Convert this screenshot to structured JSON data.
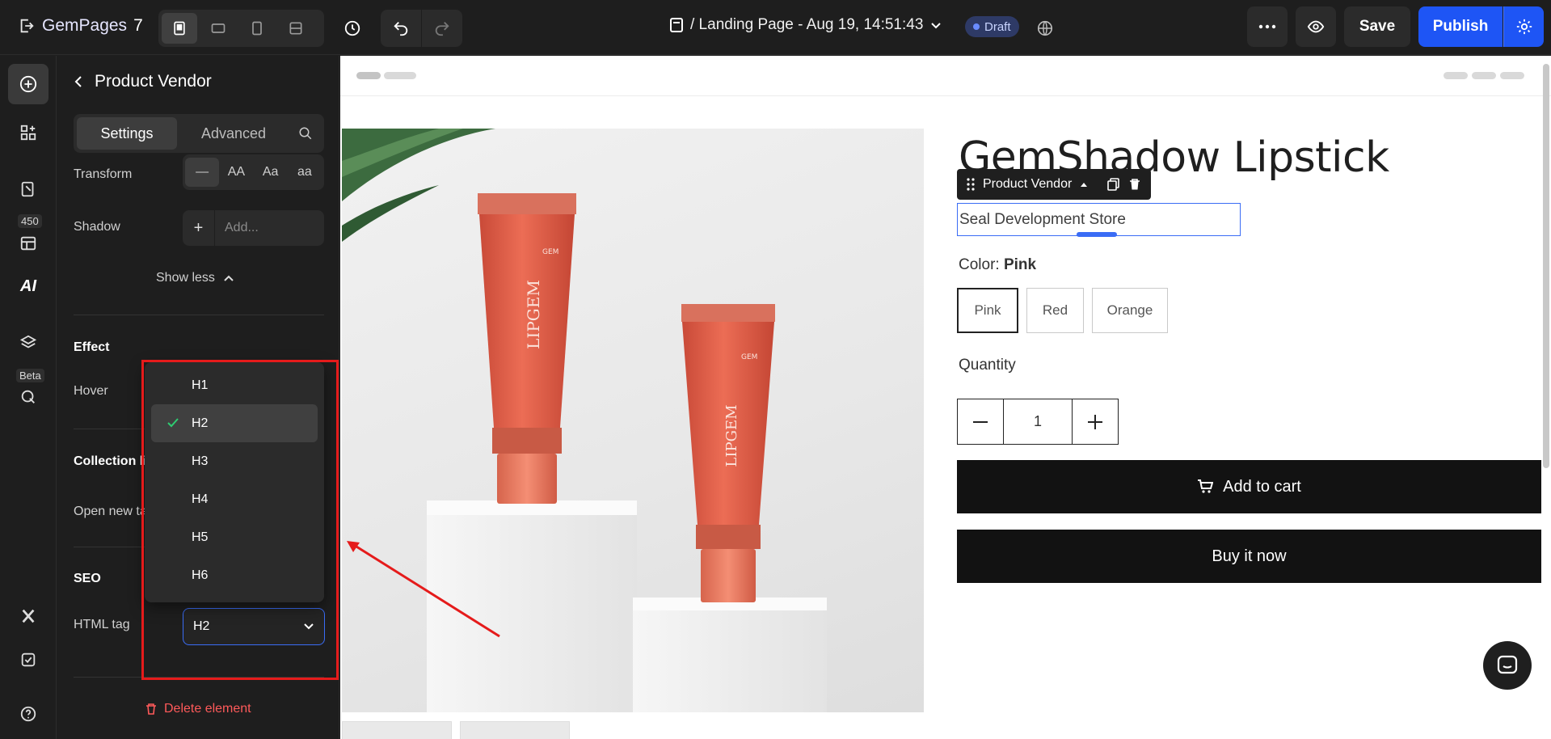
{
  "app": {
    "name": "GemPages",
    "version": "7"
  },
  "topbar": {
    "page_title": "/ Landing Page - Aug 19, 14:51:43",
    "status": "Draft",
    "save_label": "Save",
    "publish_label": "Publish",
    "device_icons": [
      "desktop-icon",
      "laptop-icon",
      "mobile-icon",
      "tablet-icon"
    ]
  },
  "rail": {
    "items": [
      "add-element-icon",
      "apps-icon",
      "pages-icon",
      "templates-icon",
      "ai-icon",
      "layers-icon",
      "inspect-icon",
      "x-icon",
      "checklist-icon",
      "help-icon"
    ],
    "badge_count": "450",
    "beta_label": "Beta",
    "ai_label": "AI"
  },
  "panel": {
    "title": "Product Vendor",
    "tabs": [
      "Settings",
      "Advanced"
    ],
    "transform_label": "Transform",
    "transform_options": [
      "—",
      "AA",
      "Aa",
      "aa"
    ],
    "shadow_label": "Shadow",
    "shadow_placeholder": "Add...",
    "show_less": "Show less",
    "effect_title": "Effect",
    "hover_label": "Hover",
    "collection_title": "Collection li",
    "open_new_tab_label": "Open new ta",
    "seo_title": "SEO",
    "html_tag_label": "HTML tag",
    "html_tag_value": "H2",
    "delete_label": "Delete element"
  },
  "dropdown": {
    "options": [
      "H1",
      "H2",
      "H3",
      "H4",
      "H5",
      "H6"
    ],
    "selected": "H2"
  },
  "canvas": {
    "product_title": "GemShadow Lipstick",
    "element_toolbar_label": "Product Vendor",
    "vendor_text": "Seal Development Store",
    "color_label": "Color:",
    "color_value": "Pink",
    "swatches": [
      "Pink",
      "Red",
      "Orange"
    ],
    "quantity_label": "Quantity",
    "quantity_value": "1",
    "add_to_cart": "Add to cart",
    "buy_now": "Buy it now",
    "tube_brand": "LIPGEM",
    "tube_logo": "GEM cosmetics"
  },
  "colors": {
    "accent": "#1e55f5",
    "highlight_box": "#e51b1b",
    "danger": "#ff5a5a",
    "tube": "#e4624c"
  }
}
